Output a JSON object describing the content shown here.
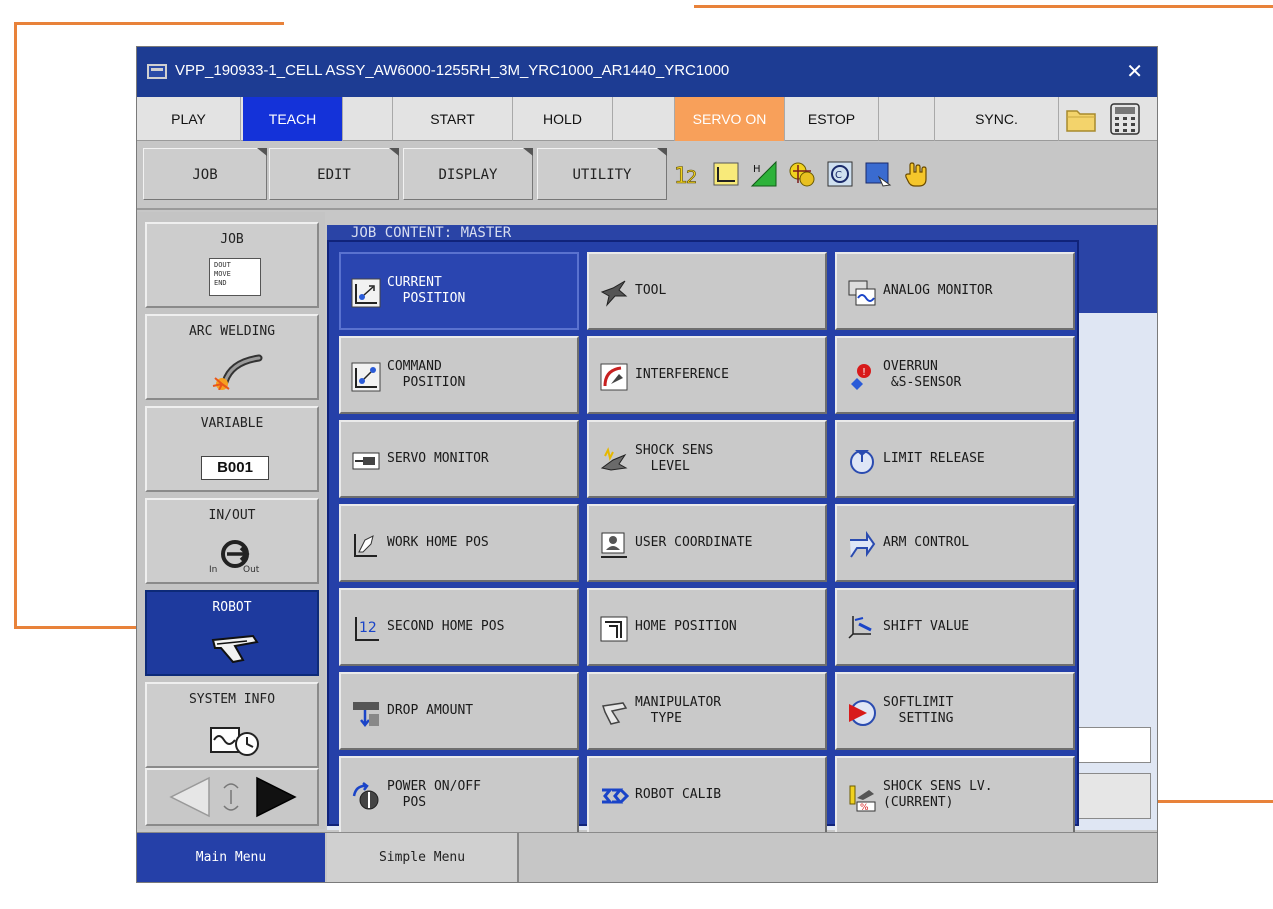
{
  "window": {
    "title": "VPP_190933-1_CELL ASSY_AW6000-1255RH_3M_YRC1000_AR1440_YRC1000",
    "close_glyph": "✕"
  },
  "status": {
    "play": "PLAY",
    "teach": "TEACH",
    "start": "START",
    "hold": "HOLD",
    "servo_on": "SERVO ON",
    "estop": "ESTOP",
    "sync": "SYNC.",
    "colors": {
      "teach": "#1432d9",
      "servo_on": "#f8a05a"
    }
  },
  "menubar": {
    "job": "JOB",
    "edit": "EDIT",
    "display": "DISPLAY",
    "utility": "UTILITY"
  },
  "left_menu": {
    "job": {
      "label": "JOB",
      "icon_text": [
        "DOUT",
        "MOVE",
        "END"
      ]
    },
    "arc_welding": {
      "label": "ARC WELDING"
    },
    "variable": {
      "label": "VARIABLE",
      "badge": "B001"
    },
    "in_out": {
      "label": "IN/OUT",
      "in": "In",
      "out": "Out"
    },
    "robot": {
      "label": "ROBOT"
    },
    "system_info": {
      "label": "SYSTEM INFO"
    }
  },
  "content": {
    "heading": "JOB CONTENT: MASTER"
  },
  "submenu": {
    "current_position": "CURRENT\n  POSITION",
    "tool": "TOOL",
    "analog_monitor": "ANALOG MONITOR",
    "command_position": "COMMAND\n  POSITION",
    "interference": "INTERFERENCE",
    "overrun_s_sensor": "OVERRUN\n &S-SENSOR",
    "servo_monitor": "SERVO MONITOR",
    "shock_sens_level": "SHOCK SENS\n  LEVEL",
    "limit_release": "LIMIT RELEASE",
    "work_home_pos": "WORK HOME POS",
    "user_coordinate": "USER COORDINATE",
    "arm_control": "ARM CONTROL",
    "second_home_pos": "SECOND HOME POS",
    "home_position": "HOME POSITION",
    "shift_value": "SHIFT VALUE",
    "drop_amount": "DROP AMOUNT",
    "manipulator_type": "MANIPULATOR\n  TYPE",
    "softlimit_setting": "SOFTLIMIT\n  SETTING",
    "power_on_off_pos": "POWER ON/OFF\n  POS",
    "robot_calib": "ROBOT CALIB",
    "shock_sens_lv_current": "SHOCK SENS LV.\n(CURRENT)",
    "percent_glyph": "%"
  },
  "bottom": {
    "main_menu": "Main Menu",
    "simple_menu": "Simple Menu"
  }
}
